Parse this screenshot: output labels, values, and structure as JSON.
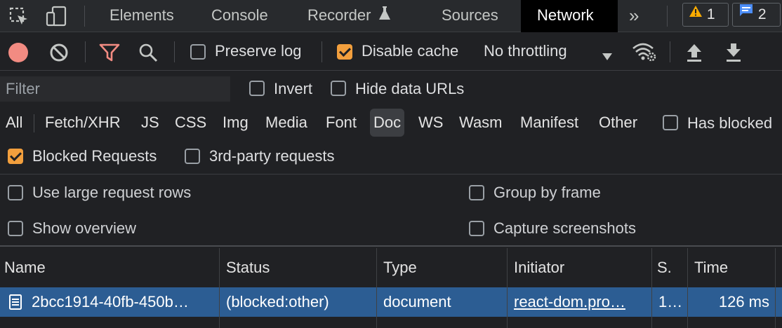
{
  "tabs": {
    "elements": "Elements",
    "console": "Console",
    "recorder": "Recorder",
    "sources": "Sources",
    "network": "Network",
    "more": "»",
    "warnings_count": "1",
    "messages_count": "2"
  },
  "toolbar": {
    "preserve_log": "Preserve log",
    "disable_cache": "Disable cache",
    "throttling": "No throttling"
  },
  "filter": {
    "placeholder": "Filter",
    "invert": "Invert",
    "hide_data_urls": "Hide data URLs"
  },
  "types": [
    "All",
    "Fetch/XHR",
    "JS",
    "CSS",
    "Img",
    "Media",
    "Font",
    "Doc",
    "WS",
    "Wasm",
    "Manifest",
    "Other"
  ],
  "has_blocked": "Has blocked",
  "blocked_requests": "Blocked Requests",
  "third_party": "3rd-party requests",
  "settings": {
    "large_rows": "Use large request rows",
    "group_by_frame": "Group by frame",
    "show_overview": "Show overview",
    "capture_screenshots": "Capture screenshots"
  },
  "table": {
    "headers": {
      "name": "Name",
      "status": "Status",
      "type": "Type",
      "initiator": "Initiator",
      "size": "S.",
      "time": "Time"
    },
    "rows": [
      {
        "name": "2bcc1914-40fb-450b…",
        "status": "(blocked:other)",
        "type": "document",
        "initiator": "react-dom.pro…",
        "size": "1…",
        "time": "126 ms"
      }
    ]
  },
  "colors": {
    "accent_orange": "#f29f3d",
    "record_red": "#f28b82",
    "selected_row": "#2c5d93",
    "warning": "#f9ab00",
    "info": "#8ab4f8"
  }
}
